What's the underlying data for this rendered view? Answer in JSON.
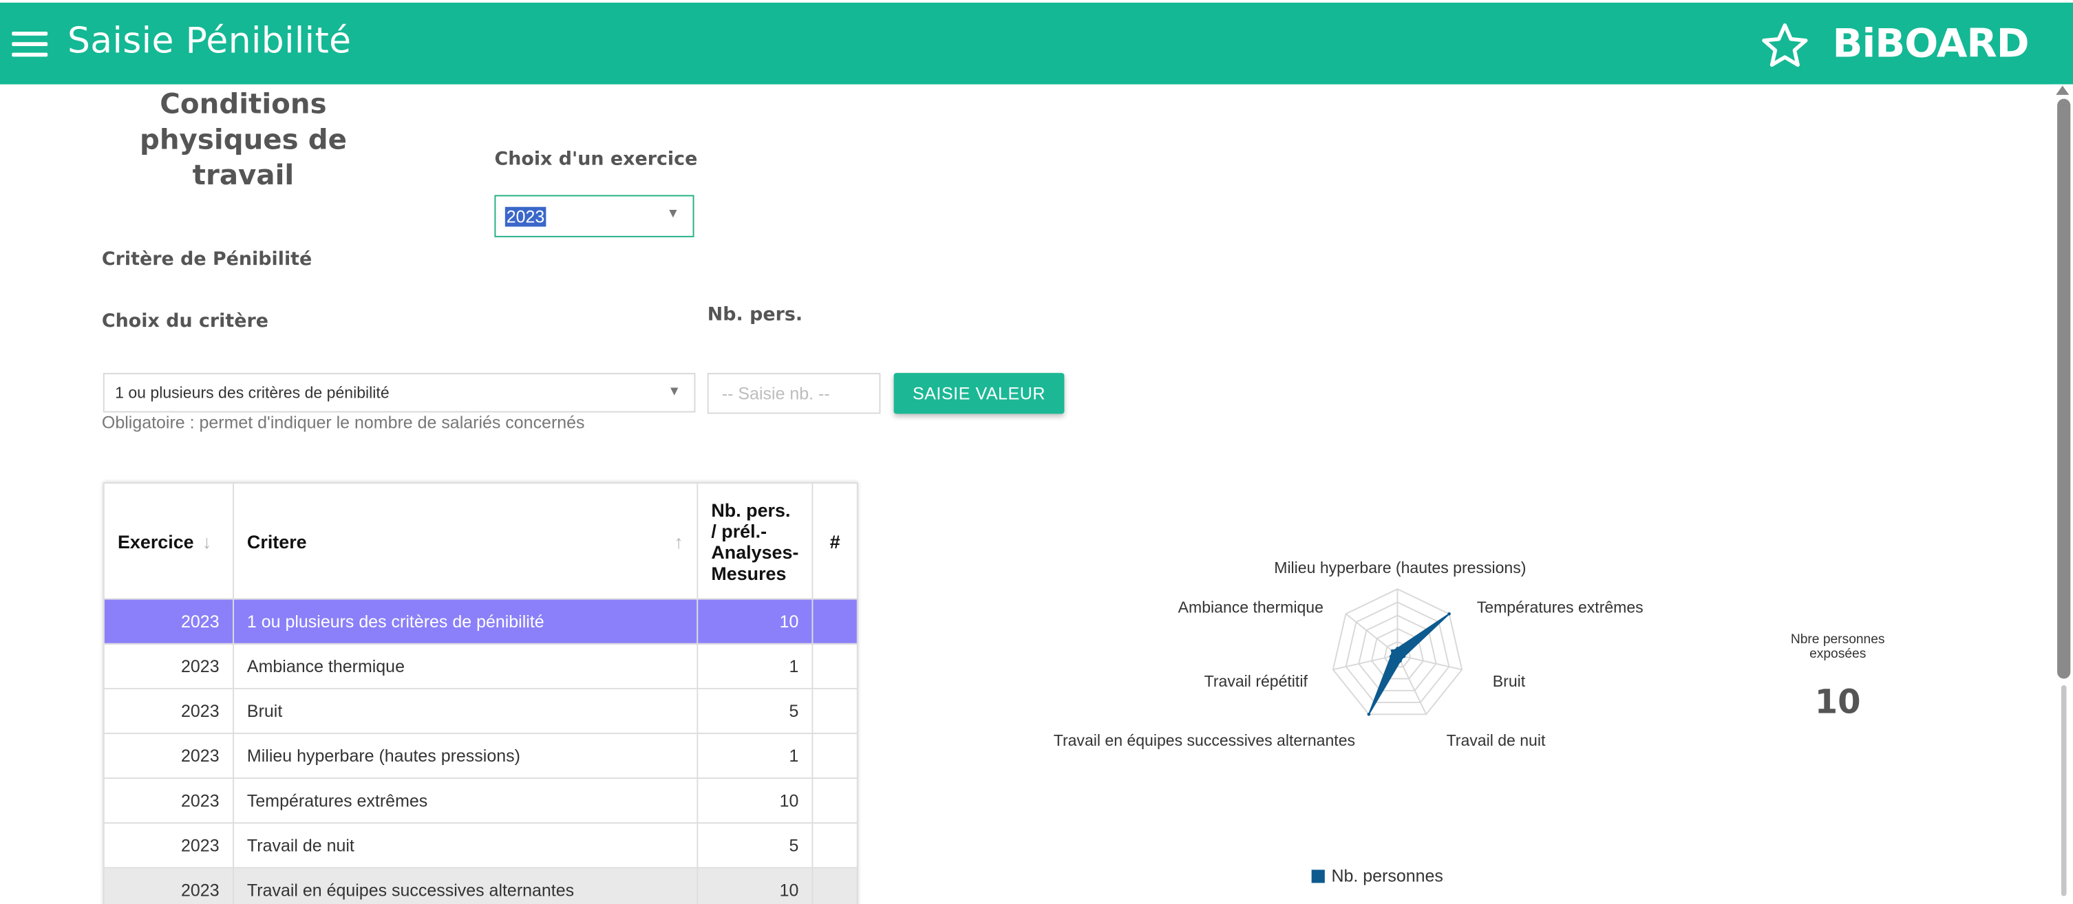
{
  "header": {
    "title": "Saisie Pénibilité",
    "logo": "BiBOARD",
    "menu_icon": "hamburger-menu-icon",
    "favorite_icon": "star-icon",
    "color": "#14b894"
  },
  "page": {
    "heading": "Conditions physiques de travail"
  },
  "exercise": {
    "label": "Choix d'un exercice",
    "selected": "2023"
  },
  "criteria": {
    "section_label": "Critère de Pénibilité",
    "choice_label": "Choix du critère",
    "selected": "1 ou plusieurs des critères de pénibilité",
    "hint": "Obligatoire : permet d'indiquer le nombre de salariés concernés"
  },
  "nb": {
    "label": "Nb. pers.",
    "placeholder": "-- Saisie nb. --",
    "button_label": "SAISIE VALEUR"
  },
  "table": {
    "columns": [
      "Exercice",
      "Critere",
      "Nb. pers. / prél.- Analyses- Mesures",
      "#"
    ],
    "rows": [
      {
        "exercice": "2023",
        "critere": "1 ou plusieurs des critères de pénibilité",
        "nb": "10",
        "selected": true
      },
      {
        "exercice": "2023",
        "critere": "Ambiance thermique",
        "nb": "1"
      },
      {
        "exercice": "2023",
        "critere": "Bruit",
        "nb": "5"
      },
      {
        "exercice": "2023",
        "critere": "Milieu hyperbare (hautes pressions)",
        "nb": "1"
      },
      {
        "exercice": "2023",
        "critere": "Températures extrêmes",
        "nb": "10"
      },
      {
        "exercice": "2023",
        "critere": "Travail de nuit",
        "nb": "5"
      },
      {
        "exercice": "2023",
        "critere": "Travail en équipes successives alternantes",
        "nb": "10"
      }
    ]
  },
  "chart_data": {
    "type": "radar",
    "categories": [
      "Milieu hyperbare (hautes pressions)",
      "Températures extrêmes",
      "Bruit",
      "Travail de nuit",
      "Travail en équipes successives alternantes",
      "Travail répétitif",
      "Ambiance thermique"
    ],
    "series": [
      {
        "name": "Nb. personnes",
        "values": [
          1,
          10,
          1,
          1,
          10,
          1,
          1
        ],
        "color": "#0d5a8f"
      }
    ],
    "rmax": 10,
    "rings": 5,
    "legend_position": "bottom"
  },
  "kpi": {
    "title": "Nbre personnes exposées",
    "value": "10"
  }
}
